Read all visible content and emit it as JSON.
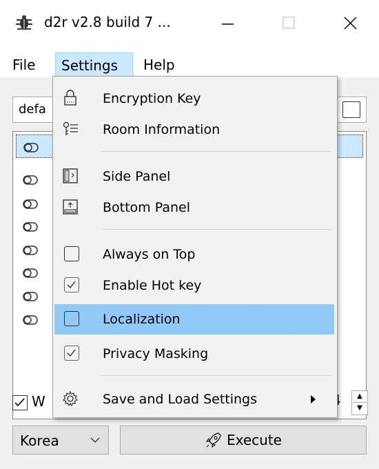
{
  "window": {
    "title": "d2r v2.8 build 7 ...",
    "icons": {
      "app": "bug-icon",
      "minimize": "minimize-icon",
      "maximize": "maximize-icon",
      "close": "close-icon"
    }
  },
  "menubar": {
    "items": [
      {
        "label": "File"
      },
      {
        "label": "Settings",
        "active": true
      },
      {
        "label": "Help"
      }
    ]
  },
  "main": {
    "profile_combo_value": "defa",
    "list_rows": 8,
    "bottom_checkbox_label": "W",
    "bottom_checkbox_checked": true,
    "spinner_value": "4",
    "region_select": {
      "value": "Korea"
    },
    "execute_button": {
      "label": "Execute",
      "icon": "rocket-icon"
    }
  },
  "settings_menu": {
    "items": [
      {
        "label": "Encryption Key",
        "icon": "lock-icon"
      },
      {
        "label": "Room Information",
        "icon": "room-info-icon"
      },
      {
        "label": "Side Panel",
        "icon": "side-panel-icon"
      },
      {
        "label": "Bottom Panel",
        "icon": "bottom-panel-icon"
      },
      {
        "label": "Always on Top",
        "checked": false
      },
      {
        "label": "Enable Hot key",
        "checked": true
      },
      {
        "label": "Localization",
        "checked": false,
        "highlighted": true
      },
      {
        "label": "Privacy Masking",
        "checked": true
      },
      {
        "label": "Save and Load Settings",
        "icon": "gear-icon",
        "submenu": true
      }
    ]
  },
  "colors": {
    "menu_highlight": "#91c9f7",
    "menubar_active": "#cce8ff",
    "selected_row": "#cce8ff",
    "window_bg": "#f0f0f0"
  }
}
